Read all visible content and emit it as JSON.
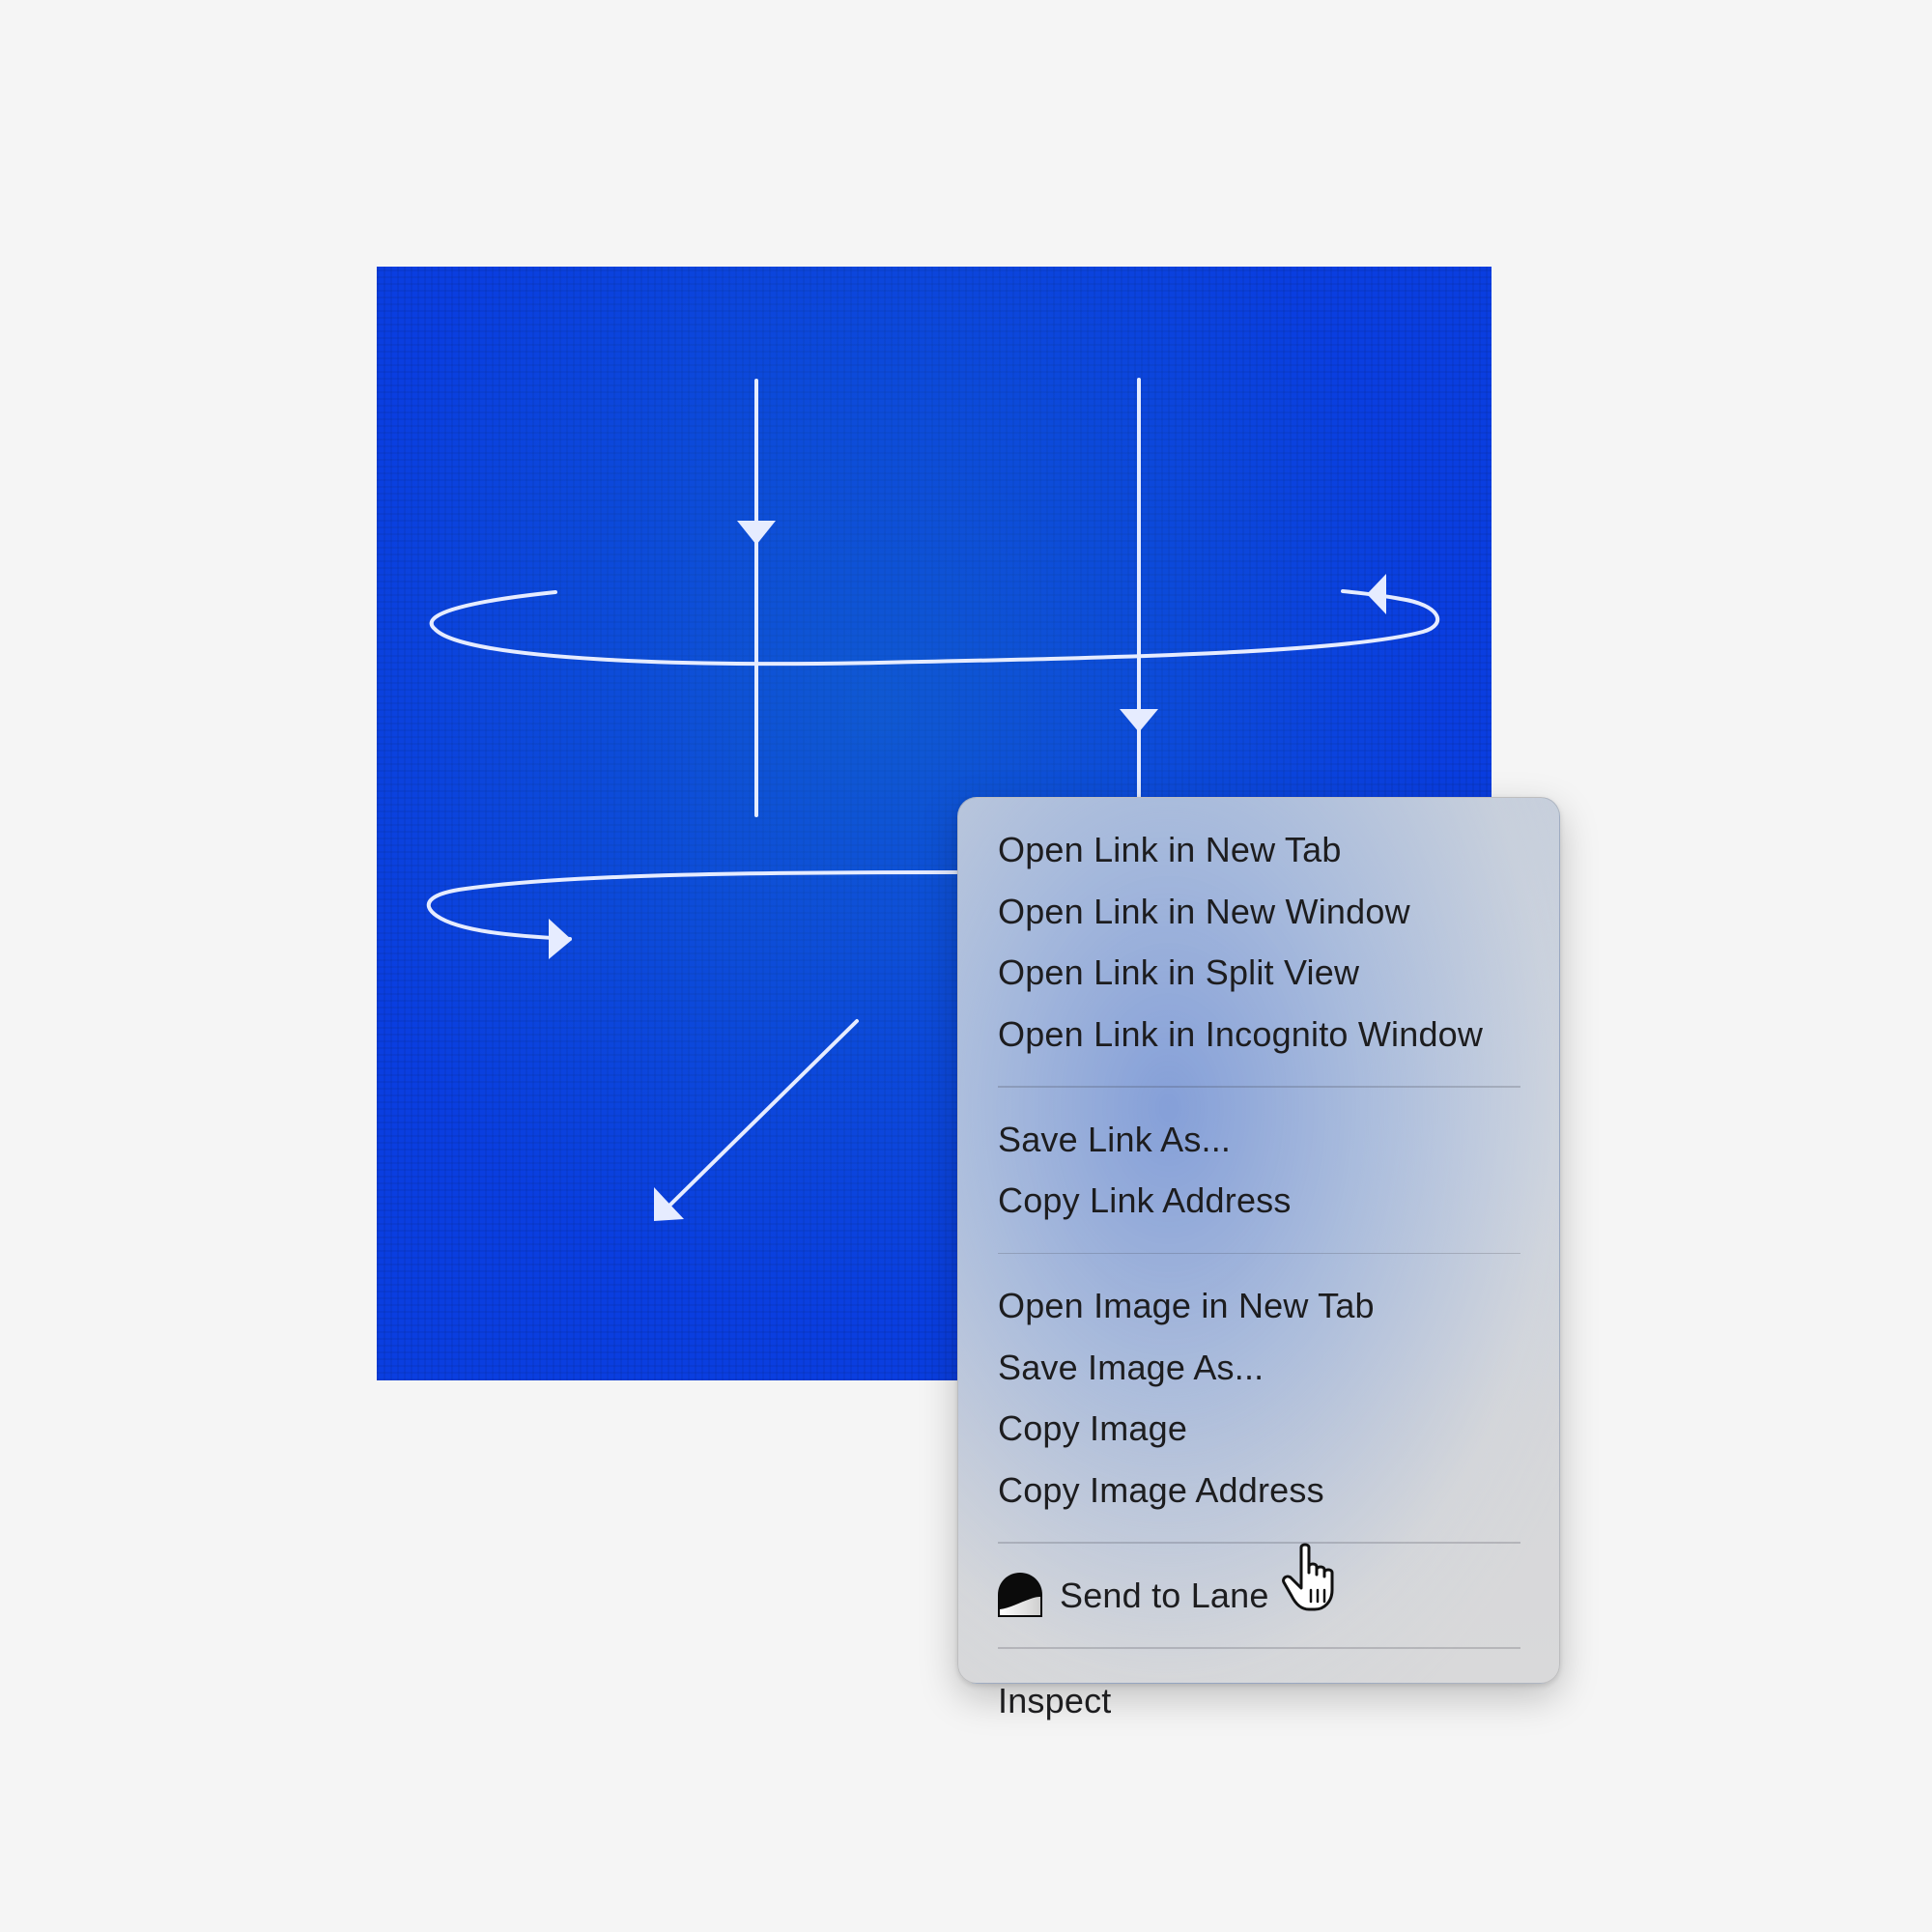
{
  "image": {
    "alt_icon": "blue-screen-arrows-illustration",
    "background_color": "#0a3ee0",
    "line_color": "#e6ecff"
  },
  "context_menu": {
    "groups": [
      {
        "items": [
          {
            "label": "Open Link in New Tab"
          },
          {
            "label": "Open Link in New Window"
          },
          {
            "label": "Open Link in Split View"
          },
          {
            "label": "Open Link in Incognito Window"
          }
        ]
      },
      {
        "items": [
          {
            "label": "Save Link As..."
          },
          {
            "label": "Copy Link Address"
          }
        ]
      },
      {
        "items": [
          {
            "label": "Open Image in New Tab"
          },
          {
            "label": "Save Image As..."
          },
          {
            "label": "Copy Image"
          },
          {
            "label": "Copy Image Address"
          }
        ]
      },
      {
        "items": [
          {
            "label": "Send to Lane",
            "icon": "lane-icon"
          }
        ]
      },
      {
        "items": [
          {
            "label": "Inspect"
          }
        ]
      }
    ]
  },
  "cursor": {
    "icon": "pointing-hand-cursor-icon"
  }
}
